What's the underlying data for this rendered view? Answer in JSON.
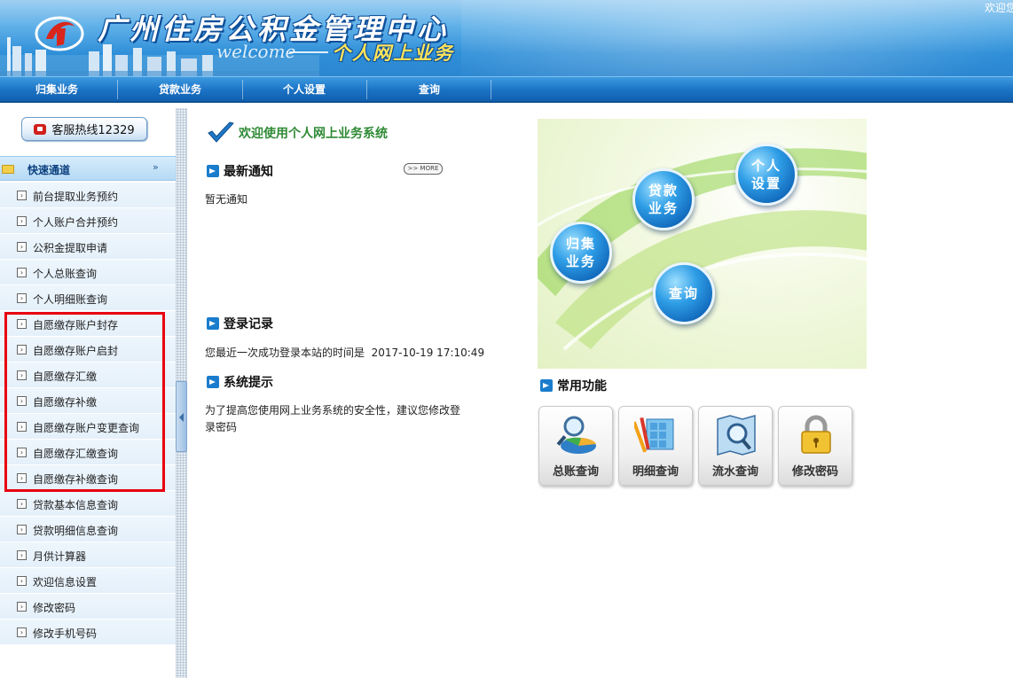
{
  "header": {
    "title": "广州住房公积金管理中心",
    "welcome": "welcome",
    "subtitle": "个人网上业务",
    "top_right": "欢迎您"
  },
  "nav": {
    "items": [
      {
        "label": "归集业务"
      },
      {
        "label": "贷款业务"
      },
      {
        "label": "个人设置"
      },
      {
        "label": "查询"
      }
    ]
  },
  "sidebar": {
    "hotline": "客服热线12329",
    "quick_title": "快速通道",
    "items": [
      {
        "label": "前台提取业务预约"
      },
      {
        "label": "个人账户合并预约"
      },
      {
        "label": "公积金提取申请"
      },
      {
        "label": "个人总账查询"
      },
      {
        "label": "个人明细账查询"
      },
      {
        "label": "自愿缴存账户封存"
      },
      {
        "label": "自愿缴存账户启封"
      },
      {
        "label": "自愿缴存汇缴"
      },
      {
        "label": "自愿缴存补缴"
      },
      {
        "label": "自愿缴存账户变更查询"
      },
      {
        "label": "自愿缴存汇缴查询"
      },
      {
        "label": "自愿缴存补缴查询"
      },
      {
        "label": "贷款基本信息查询"
      },
      {
        "label": "贷款明细信息查询"
      },
      {
        "label": "月供计算器"
      },
      {
        "label": "欢迎信息设置"
      },
      {
        "label": "修改密码"
      },
      {
        "label": "修改手机号码"
      }
    ]
  },
  "main": {
    "welcome": "欢迎使用个人网上业务系统",
    "news_title": "最新通知",
    "more_label": ">> MORE",
    "news_empty": "暂无通知",
    "login_title": "登录记录",
    "login_text": "您最近一次成功登录本站的时间是  2017-10-19 17:10:49",
    "tips_title": "系统提示",
    "tips_line1": "为了提高您使用网上业务系统的安全性，建议您修改登",
    "tips_line2": "录密码",
    "hero": {
      "orb_collect_l1": "归集",
      "orb_collect_l2": "业务",
      "orb_loan_l1": "贷款",
      "orb_loan_l2": "业务",
      "orb_personal_l1": "个人",
      "orb_personal_l2": "设置",
      "orb_query": "查询"
    },
    "common_title": "常用功能",
    "functions": [
      {
        "label": "总账查询"
      },
      {
        "label": "明细查询"
      },
      {
        "label": "流水查询"
      },
      {
        "label": "修改密码"
      }
    ]
  },
  "colors": {
    "nav_blue": "#1b72c4",
    "highlight_red": "#e8000f",
    "welcome_green": "#2f8a35"
  }
}
